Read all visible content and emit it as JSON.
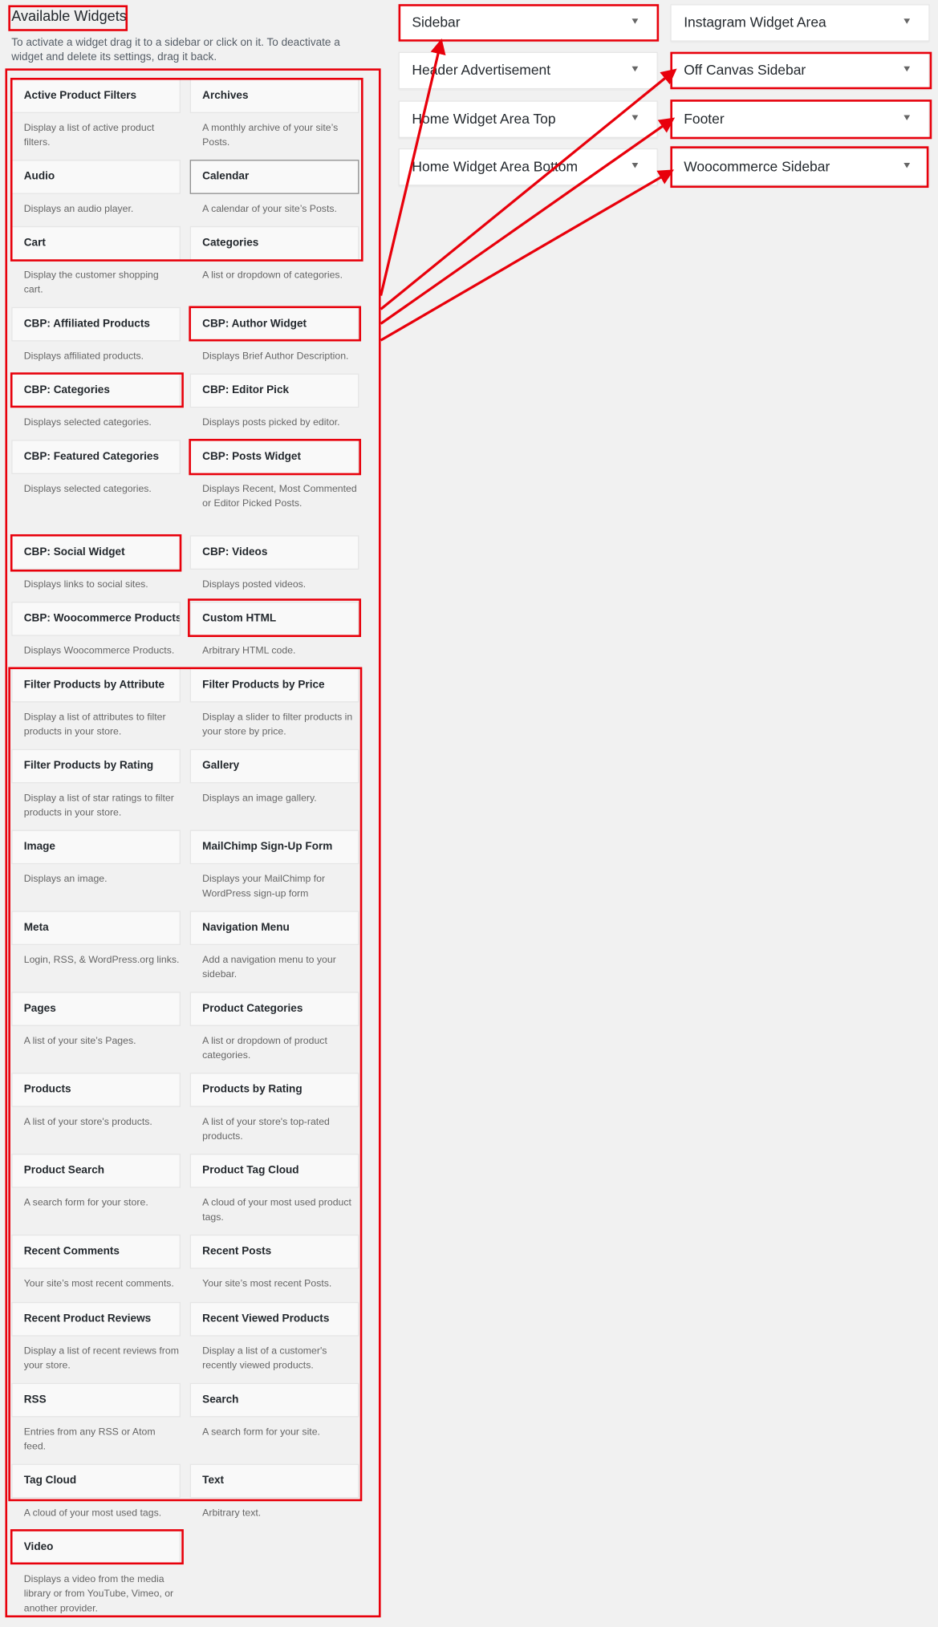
{
  "available_widgets": {
    "title": "Available Widgets",
    "description": "To activate a widget drag it to a sidebar or click on it. To deactivate a widget and delete its settings, drag it back."
  },
  "widgets": [
    {
      "title": "Active Product Filters",
      "desc": "Display a list of active product filters."
    },
    {
      "title": "Archives",
      "desc": "A monthly archive of your site’s Posts."
    },
    {
      "title": "Audio",
      "desc": "Displays an audio player."
    },
    {
      "title": "Calendar",
      "desc": "A calendar of your site’s Posts."
    },
    {
      "title": "Cart",
      "desc": "Display the customer shopping cart."
    },
    {
      "title": "Categories",
      "desc": "A list or dropdown of categories."
    },
    {
      "title": "CBP: Affiliated Products",
      "desc": "Displays affiliated products."
    },
    {
      "title": "CBP: Author Widget",
      "desc": "Displays Brief Author Description."
    },
    {
      "title": "CBP: Categories",
      "desc": "Displays selected categories."
    },
    {
      "title": "CBP: Editor Pick",
      "desc": "Displays posts picked by editor."
    },
    {
      "title": "CBP: Featured Categories",
      "desc": "Displays selected categories."
    },
    {
      "title": "CBP: Posts Widget",
      "desc": "Displays Recent, Most Commented or Editor Picked Posts."
    },
    {
      "title": "CBP: Social Widget",
      "desc": "Displays links to social sites."
    },
    {
      "title": "CBP: Videos",
      "desc": "Displays posted videos."
    },
    {
      "title": "CBP: Woocommerce Products",
      "desc": "Displays Woocommerce Products."
    },
    {
      "title": "Custom HTML",
      "desc": "Arbitrary HTML code."
    },
    {
      "title": "Filter Products by Attribute",
      "desc": "Display a list of attributes to filter products in your store."
    },
    {
      "title": "Filter Products by Price",
      "desc": "Display a slider to filter products in your store by price."
    },
    {
      "title": "Filter Products by Rating",
      "desc": "Display a list of star ratings to filter products in your store."
    },
    {
      "title": "Gallery",
      "desc": "Displays an image gallery."
    },
    {
      "title": "Image",
      "desc": "Displays an image."
    },
    {
      "title": "MailChimp Sign-Up Form",
      "desc": "Displays your MailChimp for WordPress sign-up form"
    },
    {
      "title": "Meta",
      "desc": "Login, RSS, & WordPress.org links."
    },
    {
      "title": "Navigation Menu",
      "desc": "Add a navigation menu to your sidebar."
    },
    {
      "title": "Pages",
      "desc": "A list of your site’s Pages."
    },
    {
      "title": "Product Categories",
      "desc": "A list or dropdown of product categories."
    },
    {
      "title": "Products",
      "desc": "A list of your store's products."
    },
    {
      "title": "Products by Rating",
      "desc": "A list of your store's top-rated products."
    },
    {
      "title": "Product Search",
      "desc": "A search form for your store."
    },
    {
      "title": "Product Tag Cloud",
      "desc": "A cloud of your most used product tags."
    },
    {
      "title": "Recent Comments",
      "desc": "Your site’s most recent comments."
    },
    {
      "title": "Recent Posts",
      "desc": "Your site’s most recent Posts."
    },
    {
      "title": "Recent Product Reviews",
      "desc": "Display a list of recent reviews from your store."
    },
    {
      "title": "Recent Viewed Products",
      "desc": "Display a list of a customer's recently viewed products."
    },
    {
      "title": "RSS",
      "desc": "Entries from any RSS or Atom feed."
    },
    {
      "title": "Search",
      "desc": "A search form for your site."
    },
    {
      "title": "Tag Cloud",
      "desc": "A cloud of your most used tags."
    },
    {
      "title": "Text",
      "desc": "Arbitrary text."
    },
    {
      "title": "Video",
      "desc": "Displays a video from the media library or from YouTube, Vimeo, or another provider."
    }
  ],
  "widget_areas": [
    {
      "title": "Sidebar"
    },
    {
      "title": "Instagram Widget Area"
    },
    {
      "title": "Header Advertisement"
    },
    {
      "title": "Off Canvas Sidebar"
    },
    {
      "title": "Home Widget Area Top"
    },
    {
      "title": "Footer"
    },
    {
      "title": "Home Widget Area Bottom"
    },
    {
      "title": "Woocommerce Sidebar"
    }
  ],
  "colors": {
    "annotation": "#e8000b",
    "background": "#f1f1f1",
    "widget_bg": "#f9f9f9"
  },
  "icons": {
    "area_toggle": "caret-down-icon"
  }
}
